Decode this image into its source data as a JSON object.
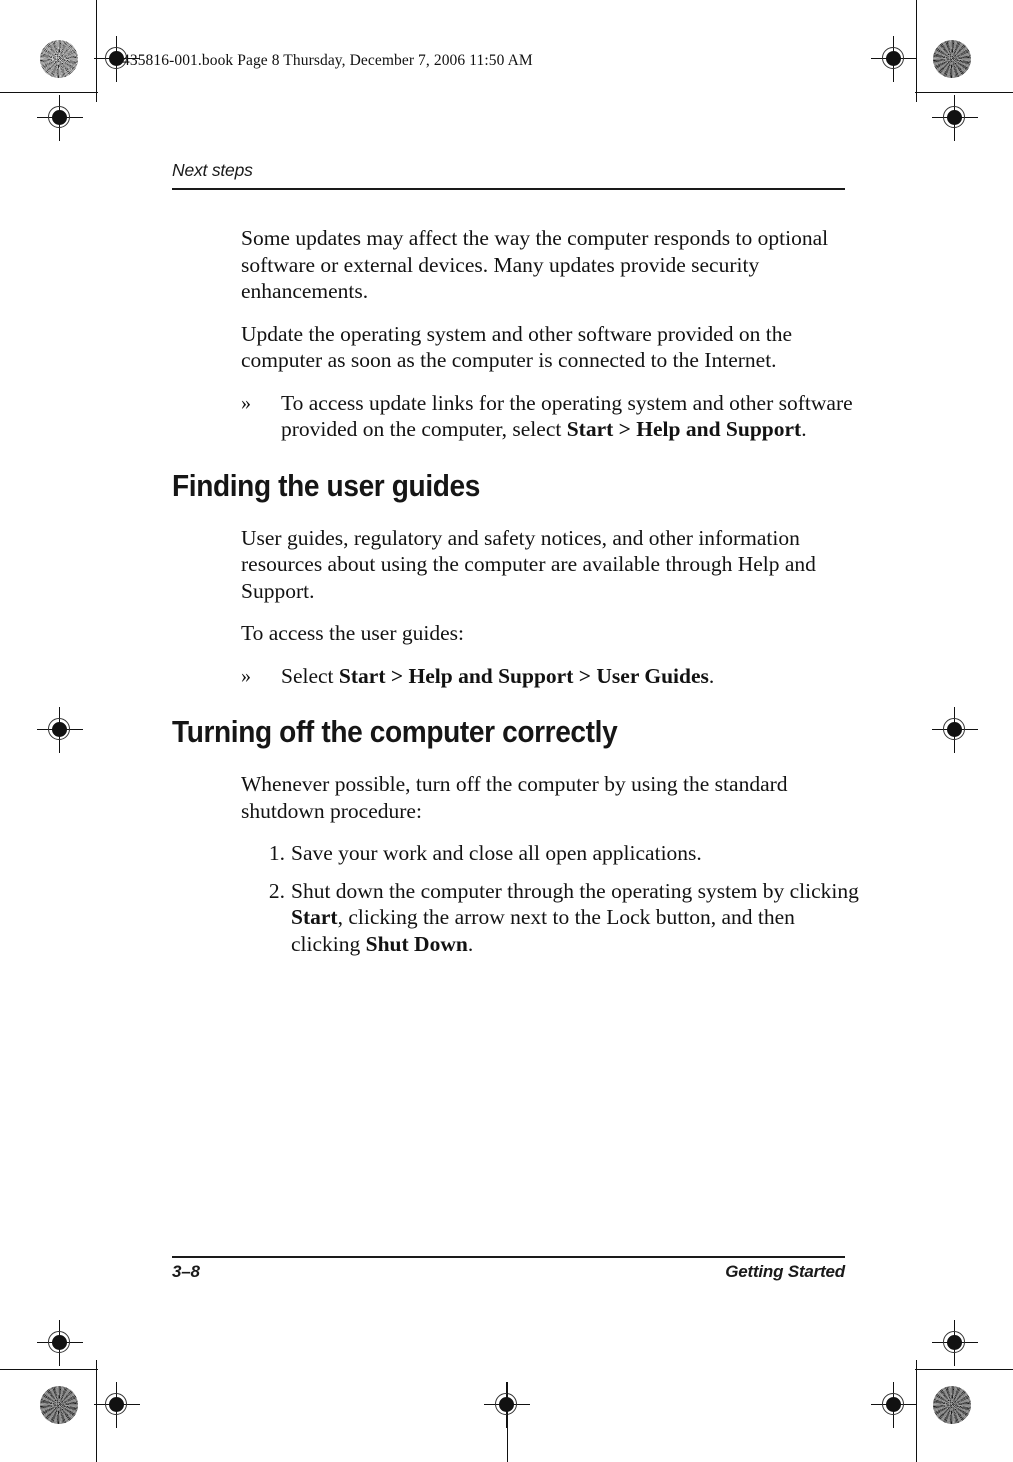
{
  "page": {
    "slug_line": "435816-001.book  Page 8  Thursday, December 7, 2006  11:50 AM",
    "running_head": "Next steps",
    "footer_page_number": "3–8",
    "footer_chapter": "Getting Started",
    "ink_color": "#121212",
    "rule_color": "#1a1a1a"
  },
  "content": {
    "para_updates_affect": "Some updates may affect the way the computer responds to optional software or external devices. Many updates provide security enhancements.",
    "para_update_os": "Update the operating system and other software provided on the computer as soon as the computer is connected to the Internet.",
    "bullet_mark": "»",
    "bullet_update_links": {
      "before": "To access update links for the operating system and other software provided on the computer, select ",
      "bold": "Start > Help and Support",
      "after": "."
    },
    "heading_finding_guides": "Finding the user guides",
    "para_user_guides": "User guides, regulatory and safety notices, and other information resources about using the computer are available through Help and Support.",
    "para_to_access": "To access the user guides:",
    "bullet_select_guides": {
      "before": "Select ",
      "bold": "Start > Help and Support > User Guides",
      "after": "."
    },
    "heading_turning_off": "Turning off the computer correctly",
    "para_whenever_possible": "Whenever possible, turn off the computer by using the standard shutdown procedure:",
    "steps": [
      {
        "number": "1.",
        "before": "Save your work and close all open applications.",
        "bold": "",
        "mid": "",
        "bold2": "",
        "after": ""
      },
      {
        "number": "2.",
        "before": "Shut down the computer through the operating system by clicking ",
        "bold": "Start",
        "mid": ", clicking the arrow next to the Lock button, and then clicking ",
        "bold2": "Shut Down",
        "after": "."
      }
    ]
  }
}
